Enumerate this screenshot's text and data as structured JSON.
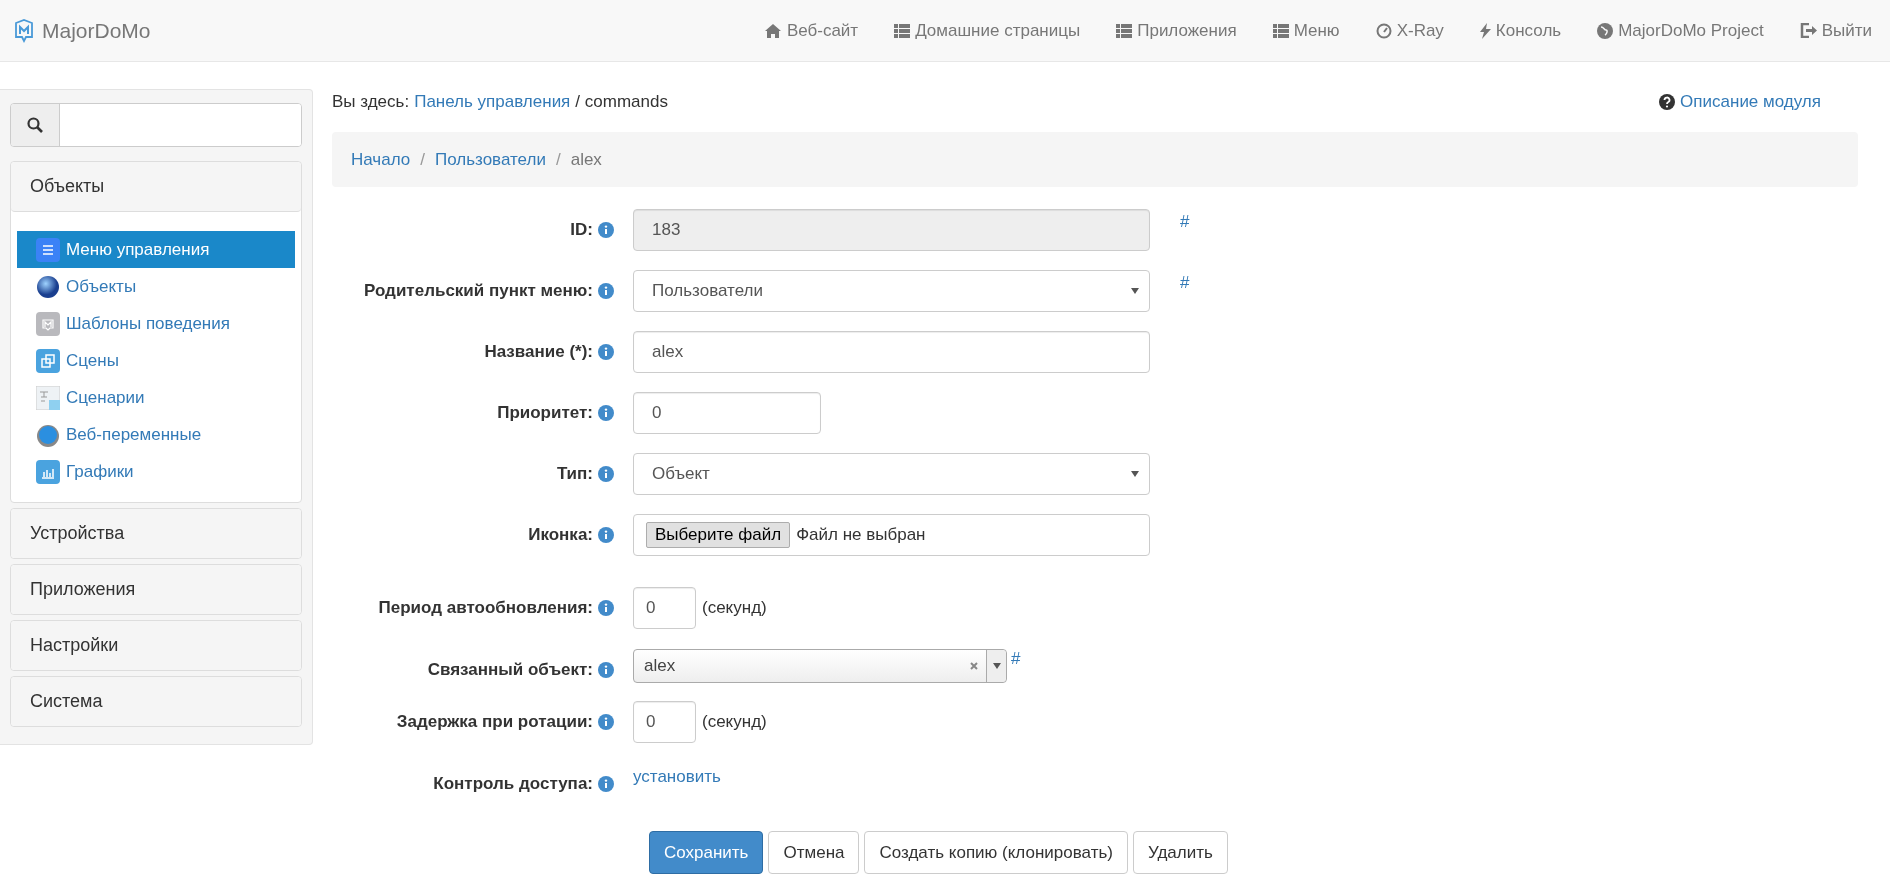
{
  "brand": "MajorDoMo",
  "nav": [
    "Веб-сайт",
    "Домашние страницы",
    "Приложения",
    "Меню",
    "X-Ray",
    "Консоль",
    "MajorDoMo Project",
    "Выйти"
  ],
  "sidebar": {
    "sections": [
      {
        "title": "Объекты",
        "expanded": true,
        "items": [
          {
            "label": "Меню управления",
            "selected": true
          },
          {
            "label": "Объекты",
            "selected": false
          },
          {
            "label": "Шаблоны поведения",
            "selected": false
          },
          {
            "label": "Сцены",
            "selected": false
          },
          {
            "label": "Сценарии",
            "selected": false
          },
          {
            "label": "Веб-переменные",
            "selected": false
          },
          {
            "label": "Графики",
            "selected": false
          }
        ]
      },
      {
        "title": "Устройства",
        "expanded": false
      },
      {
        "title": "Приложения",
        "expanded": false
      },
      {
        "title": "Настройки",
        "expanded": false
      },
      {
        "title": "Система",
        "expanded": false
      }
    ]
  },
  "location": {
    "prefix": "Вы здесь:",
    "link": "Панель управления",
    "current": "/ commands"
  },
  "module_help": "Описание модуля",
  "breadcrumb": [
    {
      "kind": "link",
      "label": "Начало"
    },
    {
      "kind": "separator",
      "label": "/"
    },
    {
      "kind": "link",
      "label": "Пользователи"
    },
    {
      "kind": "separator",
      "label": "/"
    },
    {
      "kind": "current",
      "label": "alex"
    }
  ],
  "form": [
    {
      "kind": "readonly",
      "label": "ID:",
      "value": "183",
      "hash": "#"
    },
    {
      "kind": "select",
      "label": "Родительский пункт меню:",
      "value": "Пользователи",
      "hash": "#"
    },
    {
      "kind": "text",
      "label": "Название (*):",
      "value": "alex"
    },
    {
      "kind": "short",
      "label": "Приоритет:",
      "value": "0"
    },
    {
      "kind": "select",
      "label": "Тип:",
      "value": "Объект"
    },
    {
      "kind": "file",
      "label": "Иконка:",
      "button": "Выберите файл",
      "value": "Файл не выбран"
    },
    {
      "kind": "tiny",
      "label": "Период автообновления:",
      "value": "0",
      "suffix": "(секунд)"
    },
    {
      "kind": "combo",
      "label": "Связанный объект:",
      "value": "alex",
      "hash": "#"
    },
    {
      "kind": "tiny",
      "label": "Задержка при ротации:",
      "value": "0",
      "suffix": "(секунд)"
    },
    {
      "kind": "link",
      "label": "Контроль доступа:",
      "value": "установить"
    }
  ],
  "buttons": [
    {
      "label": "Сохранить",
      "primary": true
    },
    {
      "label": "Отмена",
      "primary": false
    },
    {
      "label": "Создать копию (клонировать)",
      "primary": false
    },
    {
      "label": "Удалить",
      "primary": false
    }
  ]
}
